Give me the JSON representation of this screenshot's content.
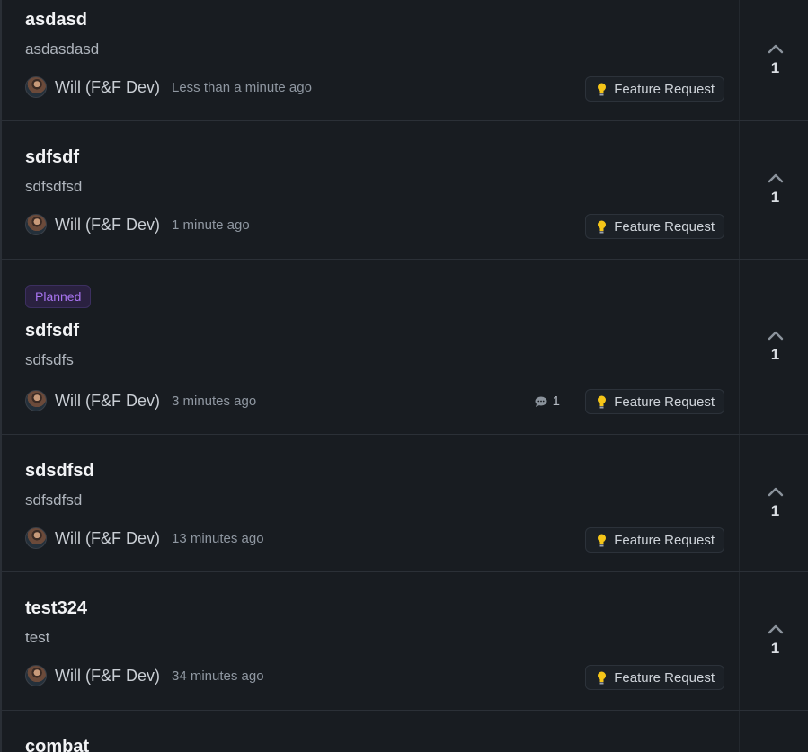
{
  "posts": [
    {
      "title": "asdasd",
      "description": "asdasdasd",
      "author": "Will (F&F Dev)",
      "time": "Less than a minute ago",
      "tag": "Feature Request",
      "votes": "1"
    },
    {
      "title": "sdfsdf",
      "description": "sdfsdfsd",
      "author": "Will (F&F Dev)",
      "time": "1 minute ago",
      "tag": "Feature Request",
      "votes": "1"
    },
    {
      "status": "Planned",
      "title": "sdfsdf",
      "description": "sdfsdfs",
      "author": "Will (F&F Dev)",
      "time": "3 minutes ago",
      "comments": "1",
      "tag": "Feature Request",
      "votes": "1"
    },
    {
      "title": "sdsdfsd",
      "description": "sdfsdfsd",
      "author": "Will (F&F Dev)",
      "time": "13 minutes ago",
      "tag": "Feature Request",
      "votes": "1"
    },
    {
      "title": "test324",
      "description": "test",
      "author": "Will (F&F Dev)",
      "time": "34 minutes ago",
      "tag": "Feature Request",
      "votes": "1"
    },
    {
      "title": "combat"
    }
  ],
  "icons": {
    "upvote": "chevron-up-icon",
    "tag": "lightbulb-icon",
    "comments": "comment-icon",
    "avatar": "avatar"
  },
  "colors": {
    "background": "#181c21",
    "status_planned": "#a874f0",
    "bulb": "#f5c518"
  }
}
